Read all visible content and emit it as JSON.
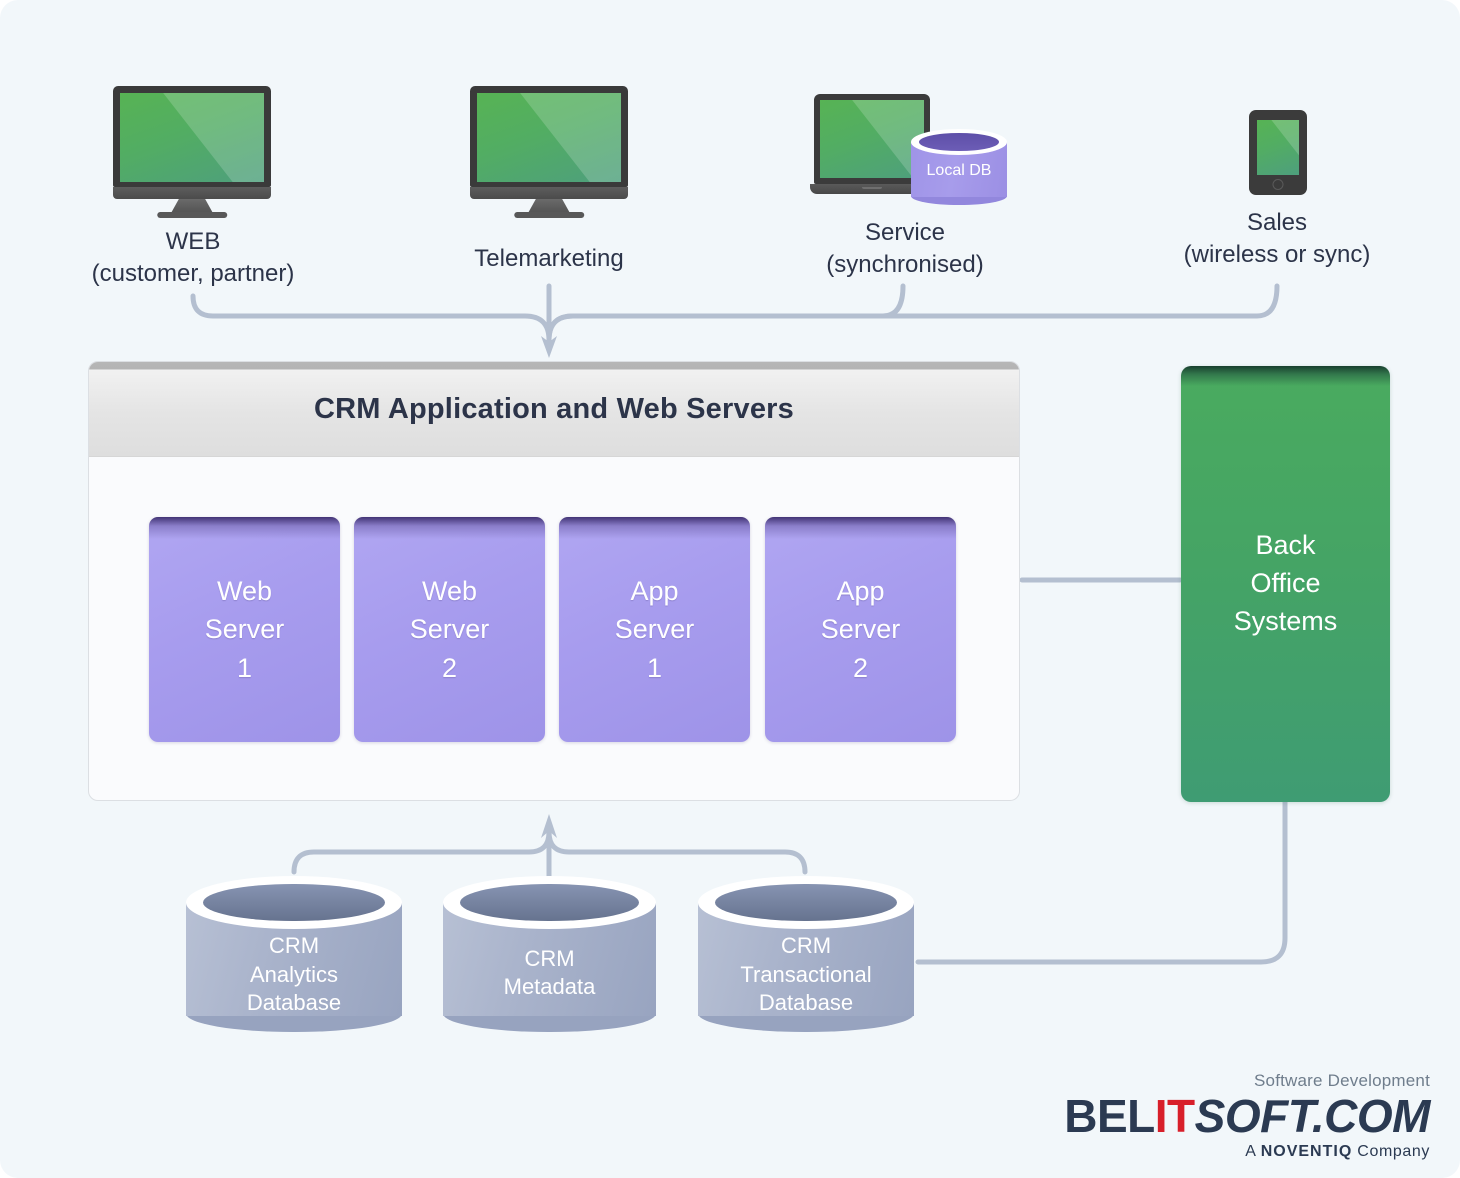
{
  "page": {
    "background": "#f2f7fa",
    "text_color": "#2c3449",
    "connector_color": "#b4bfd0"
  },
  "clients": [
    {
      "id": "web",
      "device": "desktop-monitor",
      "label": "WEB\n(customer, partner)"
    },
    {
      "id": "telemarketing",
      "device": "desktop-monitor",
      "label": "Telemarketing"
    },
    {
      "id": "service",
      "device": "laptop",
      "label": "Service\n(synchronised)",
      "local_db_label": "Local DB"
    },
    {
      "id": "sales",
      "device": "tablet",
      "label": "Sales\n(wireless or sync)"
    }
  ],
  "crm_panel": {
    "title": "CRM Application and Web Servers",
    "header_color": "#e4e4e4",
    "body_color": "#fafbfd",
    "servers": [
      {
        "id": "web-server-1",
        "label": "Web\nServer\n1"
      },
      {
        "id": "web-server-2",
        "label": "Web\nServer\n2"
      },
      {
        "id": "app-server-1",
        "label": "App\nServer\n1"
      },
      {
        "id": "app-server-2",
        "label": "App\nServer\n2"
      }
    ],
    "server_color": "#a79cee"
  },
  "back_office": {
    "label": "Back\nOffice\nSystems",
    "color": "#45a465"
  },
  "databases": [
    {
      "id": "crm-analytics-database",
      "label": "CRM\nAnalytics\nDatabase"
    },
    {
      "id": "crm-metadata",
      "label": "CRM\nMetadata"
    },
    {
      "id": "crm-transactional-database",
      "label": "CRM\nTransactional\nDatabase"
    }
  ],
  "logo": {
    "tagline": "Software Development",
    "word_1": "BEL",
    "word_it": "IT",
    "word_2": "SOFT.COM",
    "subline_prefix": "A ",
    "subline_brand": "NOVENTIQ",
    "subline_suffix": " Company"
  }
}
